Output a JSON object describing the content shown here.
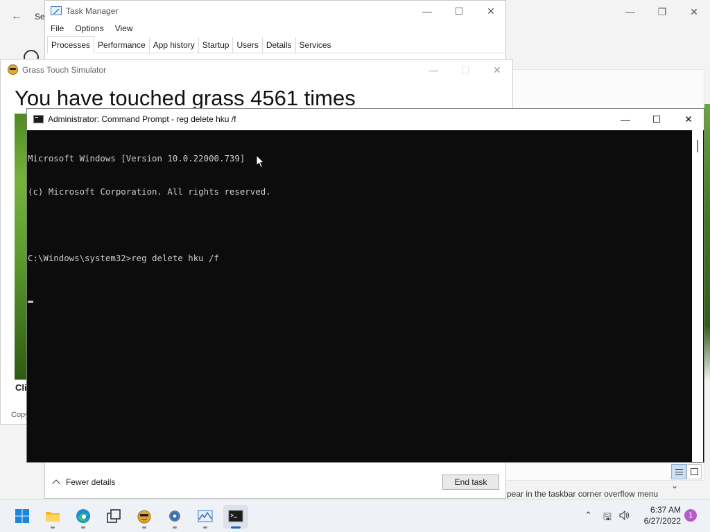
{
  "settings": {
    "title": "Se",
    "overflow_text": "pear in the taskbar corner overflow menu"
  },
  "task_manager": {
    "title": "Task Manager",
    "menu": [
      "File",
      "Options",
      "View"
    ],
    "tabs": [
      "Processes",
      "Performance",
      "App history",
      "Startup",
      "Users",
      "Details",
      "Services"
    ],
    "active_tab": "Processes",
    "fewer_details": "Fewer details",
    "end_task": "End task"
  },
  "grass_sim": {
    "title": "Grass Touch Simulator",
    "headline": "You have touched grass 4561 times",
    "click_label": "Cli",
    "copyright": "Copy"
  },
  "cmd": {
    "title": "Administrator: Command Prompt - reg  delete hku /f",
    "lines": [
      "Microsoft Windows [Version 10.0.22000.739]",
      "(c) Microsoft Corporation. All rights reserved.",
      "",
      "C:\\Windows\\system32>reg delete hku /f"
    ]
  },
  "taskbar": {
    "items": [
      {
        "name": "start-button",
        "icon": "windows-logo"
      },
      {
        "name": "file-explorer",
        "icon": "folder-icon"
      },
      {
        "name": "edge",
        "icon": "edge-icon"
      },
      {
        "name": "task-view",
        "icon": "task-view-icon"
      },
      {
        "name": "grass-simulator",
        "icon": "grass-sim-icon"
      },
      {
        "name": "settings",
        "icon": "gear-icon"
      },
      {
        "name": "task-manager",
        "icon": "task-manager-icon"
      },
      {
        "name": "command-prompt",
        "icon": "cmd-icon"
      }
    ],
    "time": "6:37 AM",
    "date": "6/27/2022",
    "notification_count": "1"
  },
  "colors": {
    "console_bg": "#0c0c0c",
    "console_text": "#cccccc",
    "accent": "#0a67c8",
    "notification": "#b65cc9"
  }
}
